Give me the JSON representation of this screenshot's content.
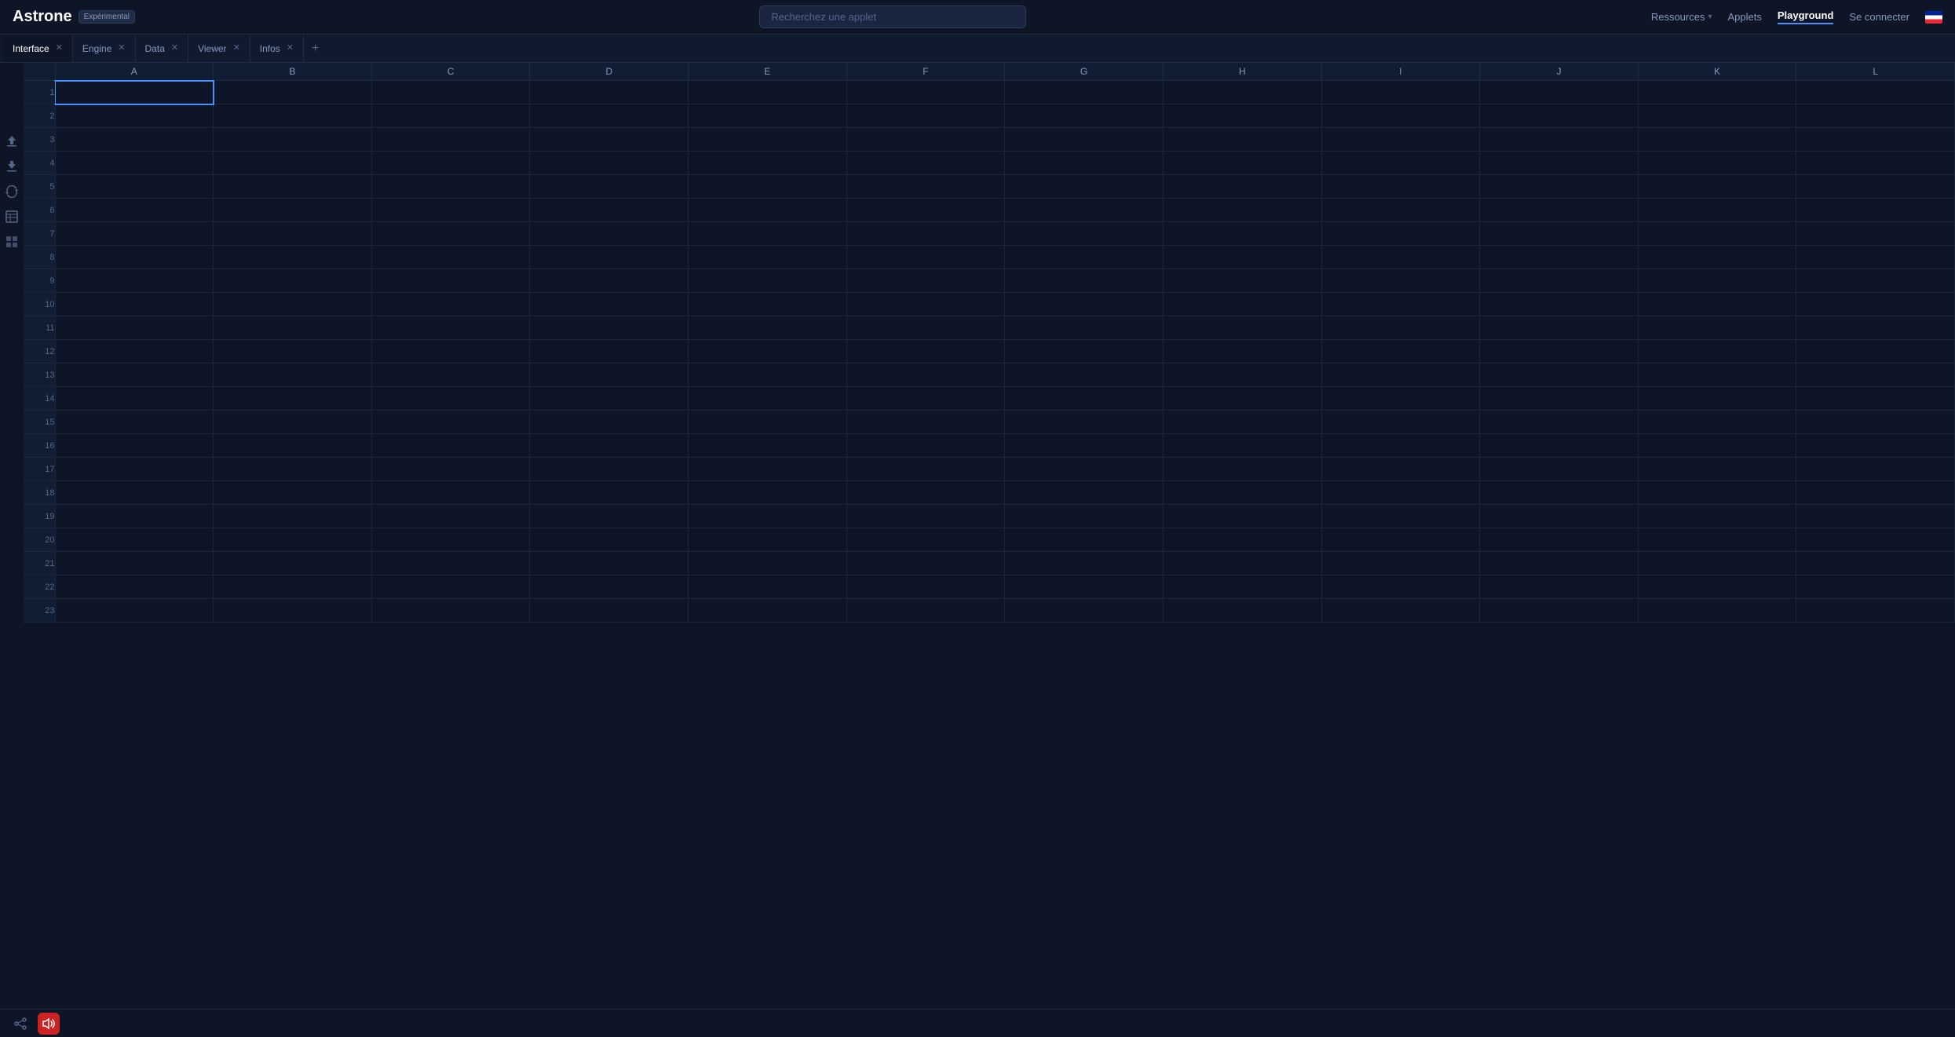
{
  "header": {
    "logo": "Astrone",
    "badge": "Expérimental",
    "search_placeholder": "Recherchez une applet",
    "nav": [
      {
        "id": "ressources",
        "label": "Ressources",
        "has_chevron": true,
        "active": false
      },
      {
        "id": "applets",
        "label": "Applets",
        "has_chevron": false,
        "active": false
      },
      {
        "id": "playground",
        "label": "Playground",
        "has_chevron": false,
        "active": true
      },
      {
        "id": "se-connecter",
        "label": "Se connecter",
        "has_chevron": false,
        "active": false
      }
    ]
  },
  "tabs": [
    {
      "id": "interface",
      "label": "Interface",
      "closable": true,
      "active": true
    },
    {
      "id": "engine",
      "label": "Engine",
      "closable": true,
      "active": false
    },
    {
      "id": "data",
      "label": "Data",
      "closable": true,
      "active": false
    },
    {
      "id": "viewer",
      "label": "Viewer",
      "closable": true,
      "active": false
    },
    {
      "id": "infos",
      "label": "Infos",
      "closable": true,
      "active": false
    }
  ],
  "sidebar": {
    "icons": [
      {
        "id": "upload-icon",
        "symbol": "↑"
      },
      {
        "id": "download-icon",
        "symbol": "↓"
      },
      {
        "id": "sync-icon",
        "symbol": "⟳"
      },
      {
        "id": "table-icon",
        "symbol": "⊞"
      },
      {
        "id": "grid-icon",
        "symbol": "▦"
      }
    ]
  },
  "spreadsheet": {
    "columns": [
      "A",
      "B",
      "C",
      "D",
      "E",
      "F",
      "G",
      "H",
      "I",
      "J",
      "K",
      "L"
    ],
    "row_count": 23,
    "selected_cell": {
      "row": 1,
      "col": "A"
    }
  },
  "bottom_bar": {
    "share_icon": "share",
    "volume_icon": "volume"
  }
}
